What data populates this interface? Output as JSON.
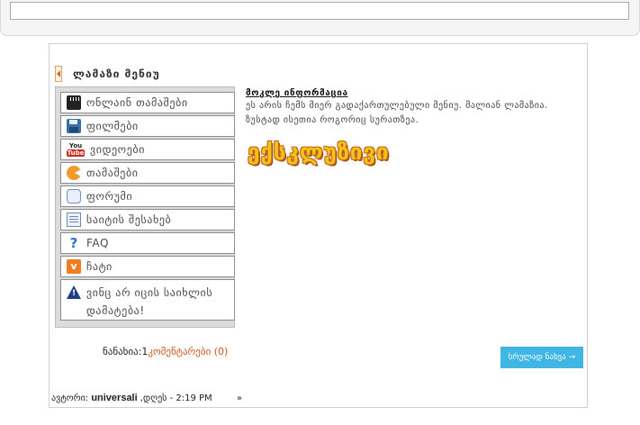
{
  "search": {
    "value": ""
  },
  "post": {
    "title": "ლამაზი მენიუ",
    "menu": [
      {
        "label": "ონლაინ თამაშები",
        "icon": "film-clapper-icon"
      },
      {
        "label": "ფილმები",
        "icon": "floppy-disk-icon"
      },
      {
        "label": "ვიდეოები",
        "icon": "youtube-icon"
      },
      {
        "label": "თამაშები",
        "icon": "pacman-icon"
      },
      {
        "label": "ფორუმი",
        "icon": "speech-bubble-icon"
      },
      {
        "label": "საიტის შესახებ",
        "icon": "document-icon"
      },
      {
        "label": "FAQ",
        "icon": "question-mark-icon"
      },
      {
        "label": "ჩატი",
        "icon": "chat-icon"
      },
      {
        "label": "ვინც არ იცის საიხლის დამატება!",
        "icon": "warning-icon"
      }
    ],
    "info_heading": "მოკლე ინფორმაცია",
    "info_text": "ეს არის ჩემს მიერ გადაქართულებული მენიუ. მალიან ლამაზია. ზუსტად ისეთია როგორიც სურათზეა.",
    "exclusive_text": "ექსკლუზივი",
    "views_label": "ნანახია:",
    "views_count": "1",
    "comments_link": "კომენტარები (0)",
    "read_more": "სრულად ნახვა →",
    "author_label": "ავტორი:",
    "author_name": "universali",
    "date_text": "დღეს - 2:19 PM",
    "raquo": "»"
  },
  "colors": {
    "accent": "#3fb6e4",
    "link": "#d2541a",
    "exclusive": "#f3c418"
  }
}
